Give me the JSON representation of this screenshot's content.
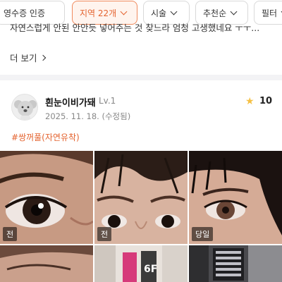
{
  "filters": [
    {
      "label": "영수증 인증",
      "active": false,
      "has_chevron": false
    },
    {
      "label": "지역 22개",
      "active": true,
      "has_chevron": true
    },
    {
      "label": "시술",
      "active": false,
      "has_chevron": true
    },
    {
      "label": "추천순",
      "active": false,
      "has_chevron": true
    },
    {
      "label": "필터",
      "active": false,
      "has_chevron": true
    }
  ],
  "previous_review": {
    "text": "자연스럽게 안된 안안듯 넣어주는 것 찾느라 엄청 고생했네요 ㅜㅜ...",
    "more_label": "더 보기"
  },
  "review": {
    "nickname": "흰눈이비가돼",
    "level": "Lv.1",
    "date": "2025. 11. 18. (수정됨)",
    "rating": "10",
    "tag": "#쌍꺼풀(자연유착)",
    "photos": [
      {
        "badge": "전",
        "icon": "eye-photo-before"
      },
      {
        "badge": "전",
        "icon": "eye-photo-before"
      },
      {
        "badge": "당일",
        "icon": "eye-photo-same-day"
      },
      {
        "badge": "",
        "icon": "eye-photo"
      },
      {
        "badge": "",
        "icon": "clinic-photo"
      },
      {
        "badge": "",
        "icon": "building-signage-photo"
      }
    ],
    "signage_text": "6F"
  },
  "colors": {
    "accent": "#e4632f",
    "star": "#f5c044"
  }
}
